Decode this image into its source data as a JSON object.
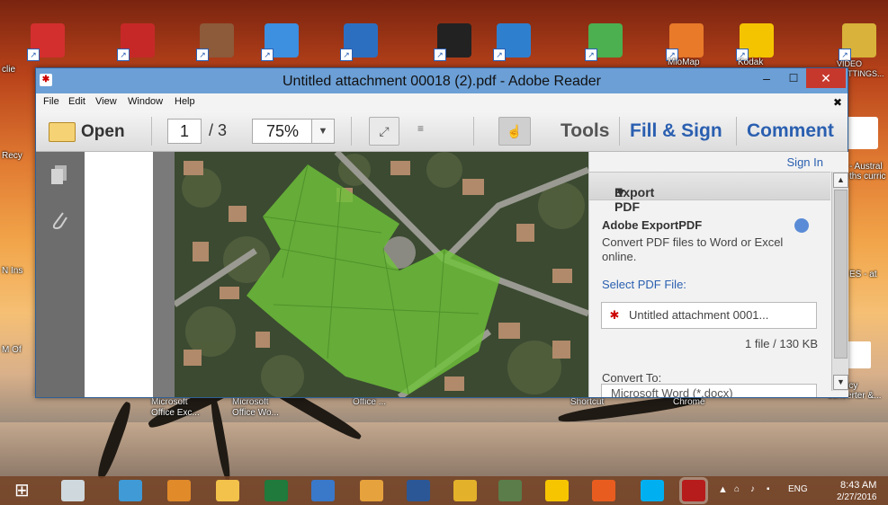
{
  "desktop": {
    "icons": [
      {
        "name": "pdf-file-icon",
        "label": "",
        "color": "#d32f2f"
      },
      {
        "name": "adobe-acrobat-icon",
        "label": "",
        "color": "#c62828"
      },
      {
        "name": "book-icon",
        "label": "",
        "color": "#8d5a3a"
      },
      {
        "name": "dropbox-icon",
        "label": "",
        "color": "#3d8fe0"
      },
      {
        "name": "hp-icon",
        "label": "",
        "color": "#2c6fc1"
      },
      {
        "name": "unity-icon",
        "label": "",
        "color": "#222"
      },
      {
        "name": "app-globe-icon",
        "label": "",
        "color": "#2f7fcf"
      },
      {
        "name": "photo-upload-icon",
        "label": "",
        "color": "#4caf50"
      },
      {
        "name": "miomap-icon",
        "label": "MioMap",
        "color": "#e87a2a"
      },
      {
        "name": "kodak-icon",
        "label": "Kodak",
        "color": "#f5c400"
      },
      {
        "name": "video-settings-icon",
        "label": "VIDEO SETTINGS...",
        "color": "#d8b23a"
      }
    ],
    "left_labels": [
      "clie",
      "Recy",
      "N Ins",
      "M Of"
    ],
    "right_labels": [
      "- Austral ths curric",
      "ES - at",
      "urrency converter &..."
    ],
    "bottom_labels": [
      "Microsoft Office Exc...",
      "Microsoft Office Wo...",
      "Office ...",
      "Shortcut",
      "Chrome"
    ]
  },
  "window": {
    "title": "Untitled attachment 00018 (2).pdf - Adobe Reader",
    "controls": {
      "minimize": "–",
      "maximize": "☐",
      "close": "✕",
      "doc_close": "✖"
    },
    "menu": [
      "File",
      "Edit",
      "View",
      "Window",
      "Help"
    ],
    "toolbar": {
      "open_label": "Open",
      "page_current": "1",
      "page_total": "/ 3",
      "zoom": "75%",
      "tools": "Tools",
      "fill_sign": "Fill & Sign",
      "comment": "Comment"
    },
    "panel": {
      "sign_in": "Sign In",
      "section": "Export PDF",
      "product": "Adobe ExportPDF",
      "description": "Convert PDF files to Word or Excel online.",
      "select_label": "Select PDF File:",
      "file_name": "Untitled attachment 0001...",
      "file_info": "1 file / 130 KB",
      "convert_to": "Convert To:",
      "convert_value": "Microsoft Word (*.docx)"
    }
  },
  "taskbar": {
    "time": "8:43 AM",
    "date": "2/27/2016",
    "lang": "ENG",
    "apps": [
      {
        "name": "start-icon",
        "color": "#ffffff"
      },
      {
        "name": "keyboard-icon",
        "color": "#cfd8dc"
      },
      {
        "name": "internet-explorer-icon",
        "color": "#3f9ad6"
      },
      {
        "name": "paint-icon",
        "color": "#e08a2a"
      },
      {
        "name": "file-explorer-icon",
        "color": "#f2c24a"
      },
      {
        "name": "excel-icon",
        "color": "#1f7a3c"
      },
      {
        "name": "outlook-contacts-icon",
        "color": "#3a78c9"
      },
      {
        "name": "calendar-icon",
        "color": "#e6a23c"
      },
      {
        "name": "word-icon",
        "color": "#2b5797"
      },
      {
        "name": "chrome-icon",
        "color": "#e3b12a"
      },
      {
        "name": "media-icon",
        "color": "#5b7d4a"
      },
      {
        "name": "norton-icon",
        "color": "#f6c500"
      },
      {
        "name": "office-icon",
        "color": "#e85d1f"
      },
      {
        "name": "skype-icon",
        "color": "#00aff0"
      },
      {
        "name": "adobe-reader-icon",
        "color": "#b71c1c"
      }
    ]
  },
  "colors": {
    "accent": "#2a5fb0",
    "map_green": "#6fc23a"
  }
}
